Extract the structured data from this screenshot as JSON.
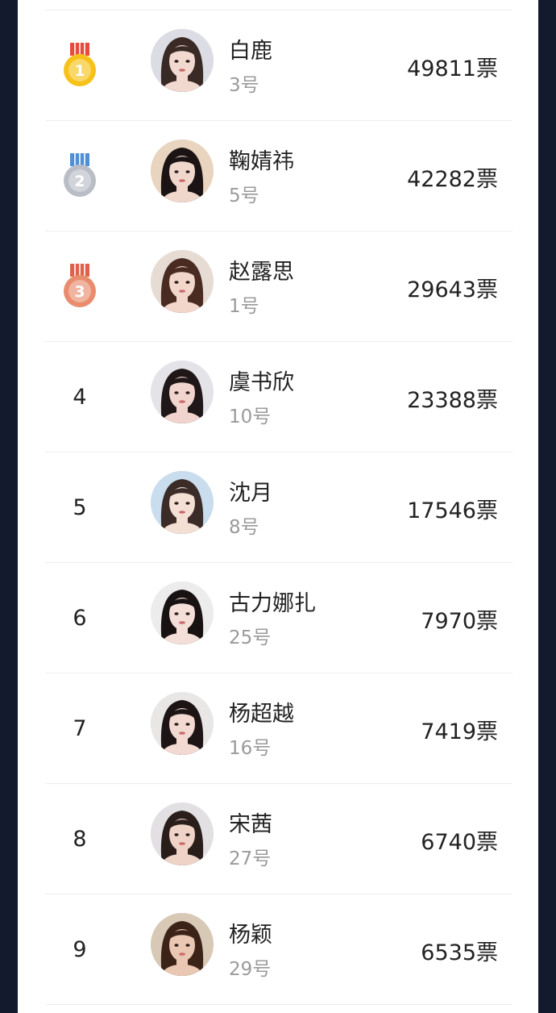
{
  "ranking": [
    {
      "rank": "1",
      "medal": "gold",
      "name": "白鹿",
      "number": "3号",
      "votes": "49811票",
      "hair": "#3a2a25",
      "skin": "#f1d9cf",
      "bg": "#dcdce4"
    },
    {
      "rank": "2",
      "medal": "silver",
      "name": "鞠婧祎",
      "number": "5号",
      "votes": "42282票",
      "hair": "#1c1414",
      "skin": "#f0d7cc",
      "bg": "#e8d4bf"
    },
    {
      "rank": "3",
      "medal": "bronze",
      "name": "赵露思",
      "number": "1号",
      "votes": "29643票",
      "hair": "#4a2b22",
      "skin": "#f1d6c9",
      "bg": "#e6dcd4"
    },
    {
      "rank": "4",
      "medal": "",
      "name": "虞书欣",
      "number": "10号",
      "votes": "23388票",
      "hair": "#1f1718",
      "skin": "#f0d4cd",
      "bg": "#e4e4e8"
    },
    {
      "rank": "5",
      "medal": "",
      "name": "沈月",
      "number": "8号",
      "votes": "17546票",
      "hair": "#3b2c28",
      "skin": "#f4dfd5",
      "bg": "#c9ddee"
    },
    {
      "rank": "6",
      "medal": "",
      "name": "古力娜扎",
      "number": "25号",
      "votes": "7970票",
      "hair": "#181212",
      "skin": "#f3dfd8",
      "bg": "#ececec"
    },
    {
      "rank": "7",
      "medal": "",
      "name": "杨超越",
      "number": "16号",
      "votes": "7419票",
      "hair": "#1d1515",
      "skin": "#f2d9d1",
      "bg": "#e9e6e6"
    },
    {
      "rank": "8",
      "medal": "",
      "name": "宋茜",
      "number": "27号",
      "votes": "6740票",
      "hair": "#2a1e1b",
      "skin": "#eed3c6",
      "bg": "#e2e0e3"
    },
    {
      "rank": "9",
      "medal": "",
      "name": "杨颖",
      "number": "29号",
      "votes": "6535票",
      "hair": "#3b2417",
      "skin": "#e9c7b2",
      "bg": "#d8c8b6"
    }
  ],
  "colors": {
    "gold": "#f6c21a",
    "gold_ribbon": "#e84a3c",
    "silver": "#b9bec6",
    "silver_ribbon": "#4f8fd8",
    "bronze": "#e98c6e",
    "bronze_ribbon": "#e0614b"
  }
}
